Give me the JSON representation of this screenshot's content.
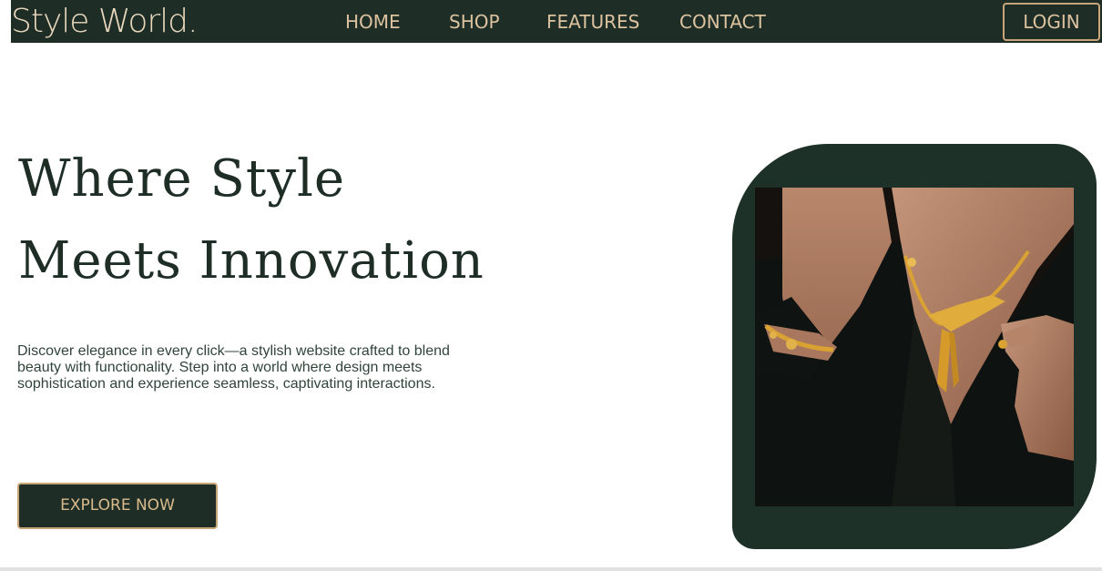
{
  "brand": "Style World.",
  "nav": {
    "items": [
      {
        "label": "HOME"
      },
      {
        "label": "SHOP"
      },
      {
        "label": "FEATURES"
      },
      {
        "label": "CONTACT"
      }
    ],
    "login_label": "LOGIN"
  },
  "hero": {
    "title_line1": "Where Style",
    "title_line2": "Meets Innovation",
    "description": "Discover elegance in every click—a stylish website crafted to blend beauty with functionality. Step into a world where design meets sophistication and experience seamless, captivating interactions.",
    "cta_label": "EXPLORE NOW"
  },
  "colors": {
    "primary": "#1e2e27",
    "accent": "#c9a67a",
    "nav_text": "#dcc29f",
    "background": "#ffffff"
  }
}
